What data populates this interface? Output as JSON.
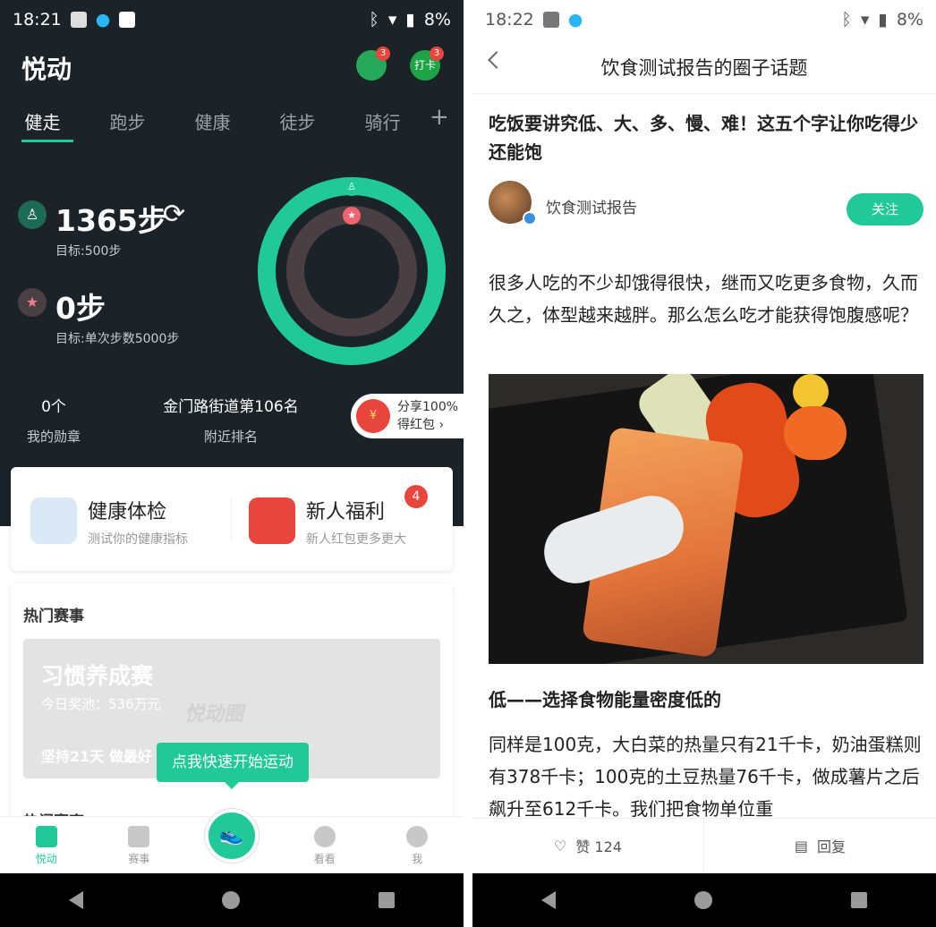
{
  "left": {
    "status": {
      "time": "18:21",
      "battery": "8%"
    },
    "app_title": "悦动",
    "header": {
      "friends_badge": "3",
      "checkin_label": "打卡",
      "checkin_badge": "3"
    },
    "tabs": [
      "健走",
      "跑步",
      "健康",
      "徒步",
      "骑行"
    ],
    "add_tab": "+",
    "steps": {
      "value": "1365步",
      "goal": "目标:500步"
    },
    "single": {
      "value": "0步",
      "goal": "目标:单次步数5000步"
    },
    "stats": [
      {
        "value": "0个",
        "label": "我的勋章"
      },
      {
        "value": "金门路街道第106名",
        "label": "附近排名"
      }
    ],
    "share": {
      "line1": "分享100%",
      "line2": "得红包",
      "arrow": "›",
      "icon": "¥"
    },
    "cards": [
      {
        "title": "健康体检",
        "sub": "测试你的健康指标"
      },
      {
        "title": "新人福利",
        "sub": "新人红包更多更大",
        "badge": "4"
      }
    ],
    "hot_title": "热门赛事",
    "banner": {
      "title": "习惯养成赛",
      "prize": "今日奖池：536万元",
      "slogan": "坚持21天 做最好",
      "watermark": "悦动圈"
    },
    "tooltip": "点我快速开始运动",
    "hot_title2": "热门赛事",
    "nav": [
      "悦动",
      "赛事",
      "看看",
      "我"
    ]
  },
  "right": {
    "status": {
      "time": "18:22",
      "battery": "8%"
    },
    "title": "饮食测试报告的圈子话题",
    "article_title": "吃饭要讲究低、大、多、慢、难！这五个字让你吃得少还能饱",
    "author": "饮食测试报告",
    "follow": "关注",
    "para1": "很多人吃的不少却饿得很快，继而又吃更多食物，久而久之，体型越来越胖。那么怎么吃才能获得饱腹感呢？",
    "subheading": "低——选择食物能量密度低的",
    "para2": "同样是100克，大白菜的热量只有21千卡，奶油蛋糕则有378千卡；100克的土豆热量76千卡，做成薯片之后飙升至612千卡。我们把食物单位重",
    "like": "赞 124",
    "reply": "回复"
  },
  "colors": {
    "accent": "#20c997",
    "dark_bg": "#1b2329",
    "badge": "#e8453c"
  }
}
